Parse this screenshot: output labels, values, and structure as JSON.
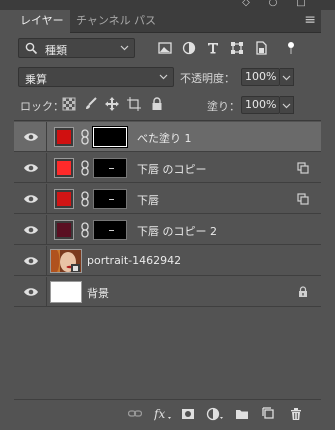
{
  "tabs": [
    {
      "label": "レイヤー",
      "active": true
    },
    {
      "label": "チャンネル",
      "active": false
    },
    {
      "label": "パス",
      "active": false
    }
  ],
  "filter": {
    "kind_label": "種類",
    "icons": [
      "pixel-filter-icon",
      "adjustment-filter-icon",
      "type-filter-icon",
      "shape-filter-icon",
      "smart-object-filter-icon",
      "filter-toggle-icon"
    ]
  },
  "blend": {
    "mode": "乗算",
    "opacity_label": "不透明度：",
    "opacity": "100%"
  },
  "lock": {
    "label": "ロック：",
    "fill_label": "塗り：",
    "fill": "100%"
  },
  "layers": [
    {
      "name": "べた塗り 1",
      "color": "#d01010",
      "selected": true,
      "kind": "fill"
    },
    {
      "name": "下唇 のコピー",
      "color": "#ff2a2a",
      "selected": false,
      "kind": "fill",
      "badge": "clip"
    },
    {
      "name": "下唇",
      "color": "#d11515",
      "selected": false,
      "kind": "fill",
      "badge": "clip"
    },
    {
      "name": "下唇 のコピー 2",
      "color": "#5a0f22",
      "selected": false,
      "kind": "fill"
    },
    {
      "name": "portrait-1462942",
      "selected": false,
      "kind": "smart"
    },
    {
      "name": "背景",
      "selected": false,
      "kind": "background",
      "badge": "lock"
    }
  ],
  "bottom_icons": [
    "link-layers-icon",
    "fx-icon",
    "add-mask-icon",
    "adjustment-layer-icon",
    "new-group-icon",
    "new-layer-icon",
    "delete-layer-icon"
  ]
}
